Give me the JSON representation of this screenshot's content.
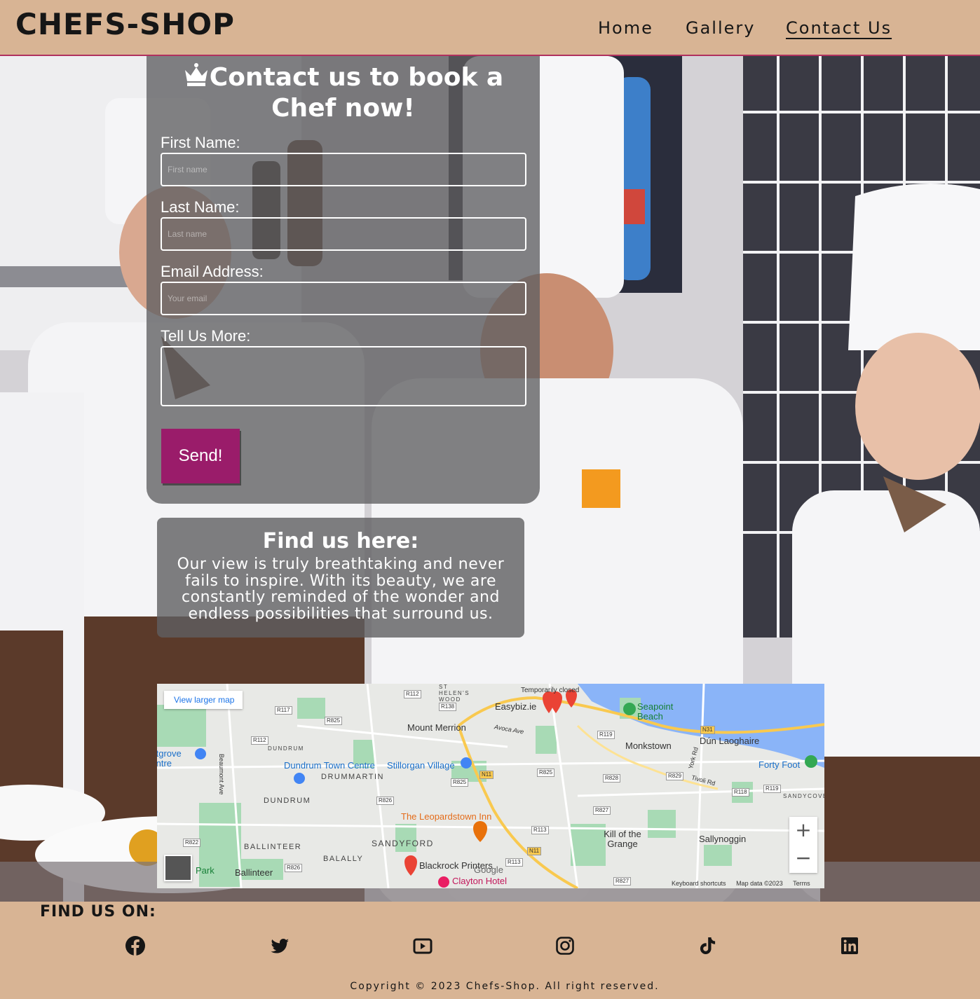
{
  "header": {
    "logo": "CHEFS-SHOP",
    "nav": [
      {
        "label": "Home"
      },
      {
        "label": "Gallery"
      },
      {
        "label": "Contact Us",
        "active": true
      }
    ]
  },
  "form": {
    "title": "Contact us to book a Chef now!",
    "title_icon": "crown-icon",
    "fields": {
      "first_name": {
        "label": "First Name:",
        "placeholder": "First name"
      },
      "last_name": {
        "label": "Last Name:",
        "placeholder": "Last name"
      },
      "email": {
        "label": "Email Address:",
        "placeholder": "Your email"
      },
      "message": {
        "label": "Tell Us More:",
        "placeholder": ""
      }
    },
    "submit_label": "Send!"
  },
  "find_us": {
    "title": "Find us here:",
    "text": "Our view is truly breathtaking and never fails to inspire. With its beauty, we are constantly reminded of the wonder and endless possibilities that surround us."
  },
  "map": {
    "view_larger": "View larger map",
    "places": {
      "mount_merrion": "Mount Merrion",
      "dundrum_town_centre": "Dundrum Town Centre",
      "stillorgan_village": "Stillorgan Village",
      "drummartin": "DRUMMARTIN",
      "dundrum": "DUNDRUM",
      "dundrum_small": "DUNDRUM",
      "ballinteer_caps": "BALLINTEER",
      "ballinteer": "Ballinteer",
      "balally": "BALALLY",
      "sandyford": "SANDYFORD",
      "leopardstown_inn": "The Leopardstown Inn",
      "blackrock_printers": "Blackrock Printers",
      "clayton_hotel": "Clayton Hotel",
      "kill_of_the_grange": "Kill of the Grange",
      "sallynoggin": "Sallynoggin",
      "monkstown": "Monkstown",
      "dun_laoghaire": "Dún Laoghaire",
      "forty_foot": "Forty Foot",
      "sandycove": "SANDYCOVE",
      "seapoint_beach": "Seapoint Beach",
      "easybiz": "Easybiz.ie",
      "temporarily_closed": "Temporarily closed",
      "st_helens_wood": "ST HELEN'S WOOD",
      "nutgrove": "Nutgrove Centre",
      "park": "Park",
      "avoca_ave": "Avoca Ave",
      "beaumont_ave": "Beaumont Ave",
      "york_rd": "York Rd",
      "tivoli_rd": "Tivoli Rd"
    },
    "roads": [
      "R112",
      "R138",
      "R117",
      "R825",
      "R112",
      "R826",
      "N11",
      "R825",
      "R825",
      "R119",
      "R828",
      "R829",
      "R118",
      "R119",
      "R827",
      "R113",
      "R113",
      "N11",
      "R822",
      "R826",
      "R827",
      "N31"
    ],
    "zoom_in": "+",
    "zoom_out": "−",
    "google": "Google",
    "footer": [
      "Keyboard shortcuts",
      "Map data ©2023",
      "Terms"
    ]
  },
  "footer": {
    "find_us_on": "FIND US ON:",
    "socials": [
      {
        "icon": "facebook-icon"
      },
      {
        "icon": "twitter-icon"
      },
      {
        "icon": "youtube-icon"
      },
      {
        "icon": "instagram-icon"
      },
      {
        "icon": "tiktok-icon"
      },
      {
        "icon": "linkedin-icon"
      }
    ],
    "copyright": "Copyright © 2023 Chefs-Shop. All right reserved."
  },
  "colors": {
    "header_bg": "#d8b494",
    "accent": "#9a1c6a",
    "header_border": "#b0305e",
    "panel": "#5f5f62"
  }
}
